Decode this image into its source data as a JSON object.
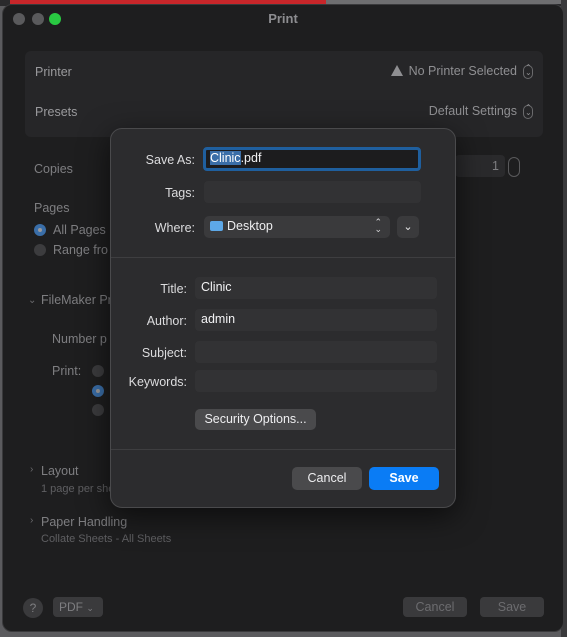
{
  "window": {
    "title": "Print"
  },
  "print_panel": {
    "printer_label": "Printer",
    "printer_value": "No Printer Selected",
    "presets_label": "Presets",
    "presets_value": "Default Settings",
    "copies_label": "Copies",
    "copies_value": "1",
    "pages_label": "Pages",
    "all_pages": "All Pages",
    "range_from": "Range fro",
    "filemaker_section": "FileMaker Pr",
    "number_pages": "Number p",
    "print_label": "Print:",
    "layout_section": "Layout",
    "layout_summary": "1 page per she",
    "paper_section": "Paper Handling",
    "paper_summary": "Collate Sheets - All Sheets",
    "help": "?",
    "pdf_label": "PDF",
    "cancel_label": "Cancel",
    "save_label": "Save"
  },
  "save_dialog": {
    "save_as_label": "Save As:",
    "save_as_selected": "Clinic",
    "save_as_ext": ".pdf",
    "tags_label": "Tags:",
    "where_label": "Where:",
    "where_value": "Desktop",
    "title_label": "Title:",
    "title_value": "Clinic",
    "author_label": "Author:",
    "author_value": "admin",
    "subject_label": "Subject:",
    "subject_value": "",
    "keywords_label": "Keywords:",
    "keywords_value": "",
    "security_button": "Security Options...",
    "cancel_button": "Cancel",
    "save_button": "Save"
  },
  "colors": {
    "accent": "#0a7cf5",
    "selection": "#3a6ea8",
    "folder": "#5da8e8"
  }
}
